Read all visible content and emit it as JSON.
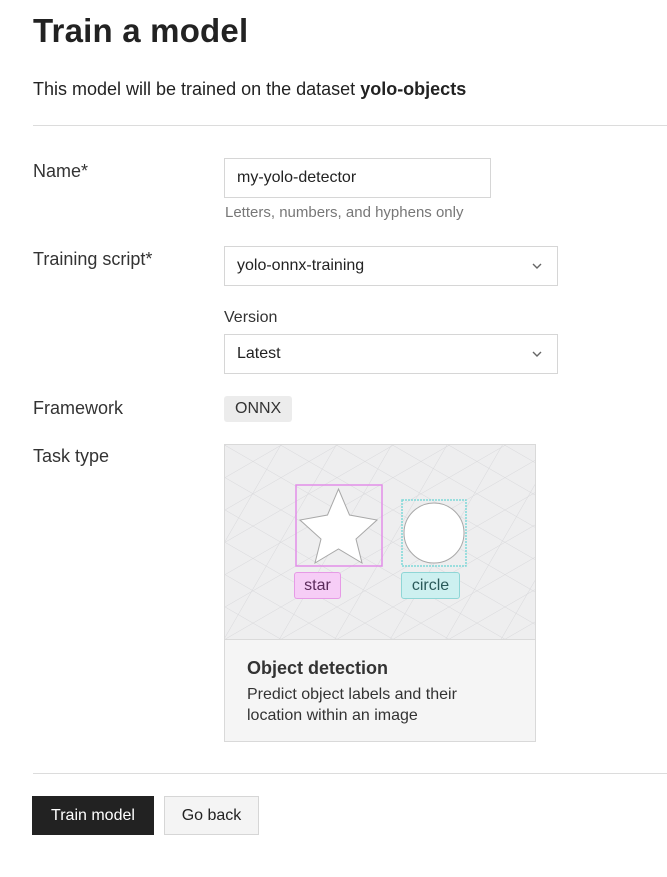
{
  "page": {
    "title": "Train a model",
    "subtitle_prefix": "This model will be trained on the dataset ",
    "dataset_name": "yolo-objects"
  },
  "form": {
    "name": {
      "label": "Name*",
      "value": "my-yolo-detector",
      "hint": "Letters, numbers, and hyphens only"
    },
    "training_script": {
      "label": "Training script*",
      "selected": "yolo-onnx-training",
      "icon": "chevron-down-icon"
    },
    "version": {
      "label": "Version",
      "selected": "Latest",
      "icon": "chevron-down-icon"
    },
    "framework": {
      "label": "Framework",
      "value": "ONNX"
    },
    "task_type": {
      "label": "Task type",
      "card": {
        "title": "Object detection",
        "description": "Predict object labels and their location within an image",
        "labels": [
          "star",
          "circle"
        ],
        "colors": {
          "star": "#e28ee8",
          "circle": "#7fd8d8",
          "background": "#eeeeef"
        }
      }
    }
  },
  "actions": {
    "primary_label": "Train model",
    "secondary_label": "Go back"
  },
  "colors": {
    "primary_button": "#222222",
    "divider": "#dcdcdc",
    "tag_background": "#ececec"
  }
}
